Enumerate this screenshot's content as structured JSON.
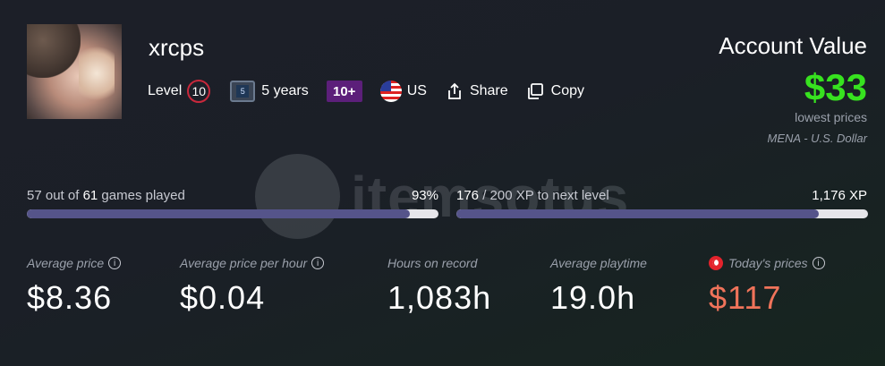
{
  "profile": {
    "username": "xrcps",
    "level_label": "Level",
    "level": "10",
    "years_badge": "5",
    "years_text": "5 years",
    "age_badge": "10+",
    "country": "US",
    "share_label": "Share",
    "copy_label": "Copy"
  },
  "account": {
    "title": "Account Value",
    "value": "$33",
    "subtitle": "lowest prices",
    "region": "MENA - U.S. Dollar"
  },
  "watermark": {
    "text": "itemsotus"
  },
  "progress": {
    "games": {
      "prefix": "57 out of ",
      "total": "61",
      "suffix": " games played",
      "percent_text": "93%",
      "fill_fraction": 0.93
    },
    "xp": {
      "current": "176",
      "rest": " / 200 XP to next level",
      "total_text": "1,176 XP",
      "fill_fraction": 0.88
    }
  },
  "stats": [
    {
      "label": "Average price",
      "value": "$8.36",
      "has_info": true
    },
    {
      "label": "Average price per hour",
      "value": "$0.04",
      "has_info": true
    },
    {
      "label": "Hours on record",
      "value": "1,083h",
      "has_info": false
    },
    {
      "label": "Average playtime",
      "value": "19.0h",
      "has_info": false
    },
    {
      "label": "Today's prices",
      "value": "$117",
      "has_info": true
    }
  ],
  "colors": {
    "accent_green": "#37e21f",
    "level_ring": "#c8283c",
    "progress_fill": "#55548a",
    "today_price": "#f0735a"
  }
}
